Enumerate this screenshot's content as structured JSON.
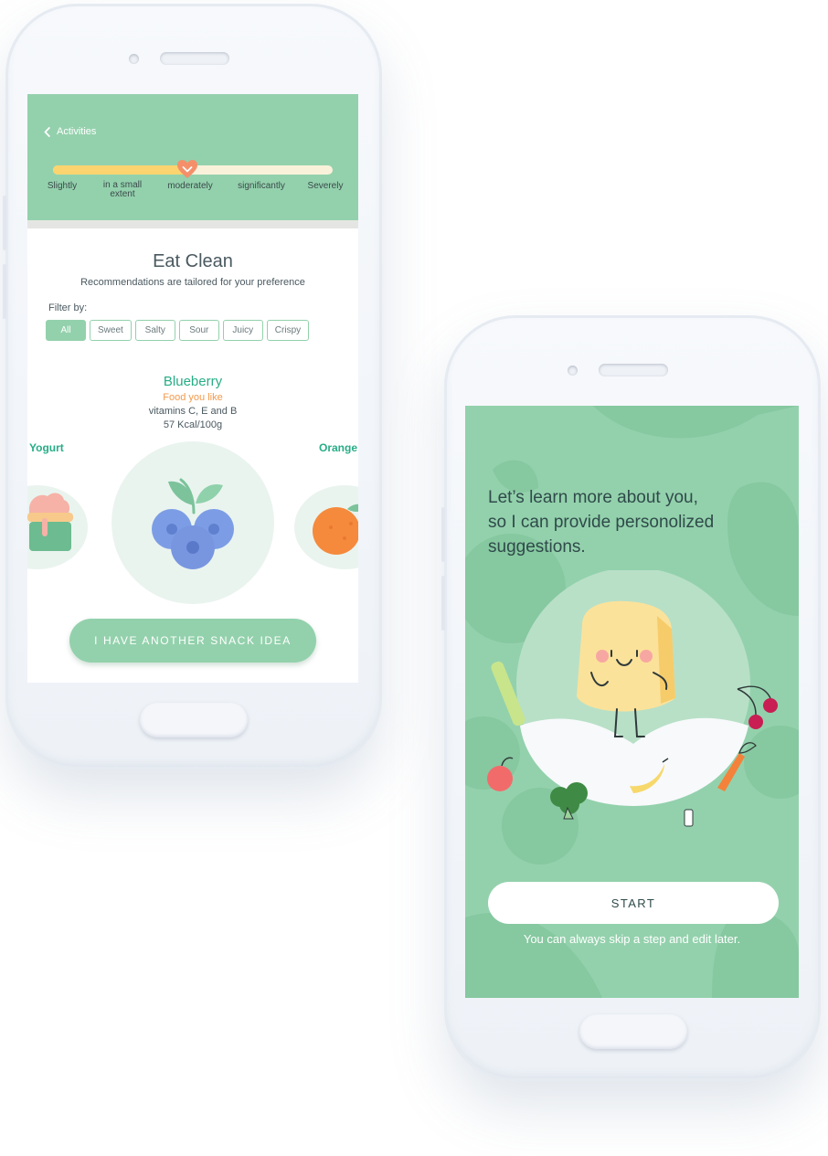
{
  "screen1": {
    "back_label": "Activities",
    "slider": {
      "labels": [
        "Slightly",
        "in a small extent",
        "moderately",
        "significantly",
        "Severely"
      ],
      "selected": "moderately",
      "fill_fraction": 0.48
    },
    "title": "Eat Clean",
    "subtitle": "Recommendations are tailored for your preference",
    "filter_label": "Filter by:",
    "filters": [
      "All",
      "Sweet",
      "Salty",
      "Sour",
      "Juicy",
      "Crispy"
    ],
    "active_filter": "All",
    "food": {
      "name": "Blueberry",
      "tag": "Food you like",
      "vitamins": "vitamins C, E and B",
      "kcal": "57 Kcal/100g"
    },
    "prev_food": "Yogurt",
    "next_food": "Orange",
    "snack_button": "I HAVE ANOTHER SNACK IDEA"
  },
  "screen2": {
    "intro": [
      "Let’s learn more about you,",
      "so I can provide personolized",
      "suggestions."
    ],
    "start_button": "START",
    "skip_note": "You can always skip a step and edit later."
  },
  "colors": {
    "mint": "#93d1ac",
    "green_text": "#27ad86",
    "orange_text": "#f39a4d",
    "slider_fill": "#fbd46f",
    "slider_track": "#faf1da",
    "blueberry": "#7c9de5"
  }
}
